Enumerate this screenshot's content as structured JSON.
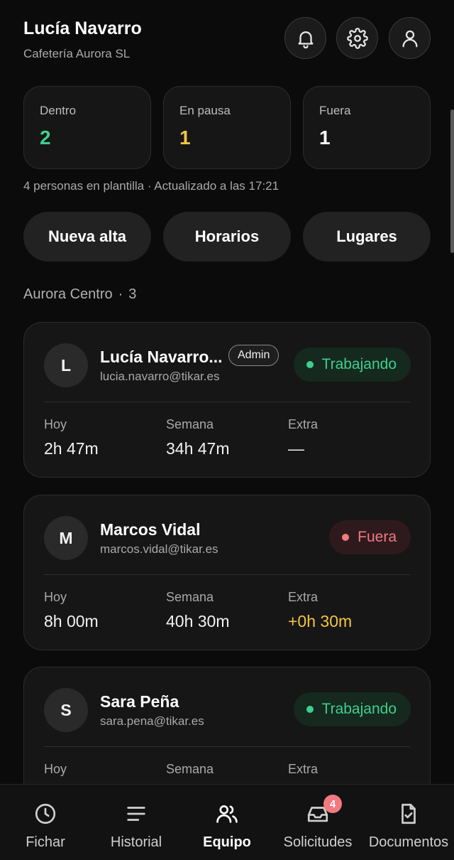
{
  "header": {
    "user_name": "Lucía Navarro",
    "company": "Cafetería Aurora SL",
    "buttons": [
      {
        "icon": "bell-icon"
      },
      {
        "icon": "gear-icon"
      },
      {
        "icon": "user-icon"
      }
    ]
  },
  "stats": [
    {
      "label": "Dentro",
      "value": "2",
      "color": "#3ecf8e"
    },
    {
      "label": "En pausa",
      "value": "1",
      "color": "#f5c542"
    },
    {
      "label": "Fuera",
      "value": "1",
      "color": "#ffffff"
    }
  ],
  "summary": "4 personas en plantilla · Actualizado a las 17:21",
  "actions": {
    "new_label": "Nueva alta",
    "schedules_label": "Horarios",
    "places_label": "Lugares"
  },
  "group": {
    "name": "Aurora Centro",
    "separator": "·",
    "count": "3"
  },
  "metric_labels": {
    "today": "Hoy",
    "week": "Semana",
    "extra": "Extra"
  },
  "employees": [
    {
      "initial": "L",
      "name": "Lucía Navarro...",
      "email": "lucia.navarro@tikar.es",
      "role": "Admin",
      "status": "Trabajando",
      "status_color": "#3ecf8e",
      "status_bg": "#15291f",
      "today": "2h 47m",
      "week": "34h 47m",
      "extra": "—",
      "extra_color": "#f2f2f2"
    },
    {
      "initial": "M",
      "name": "Marcos Vidal",
      "email": "marcos.vidal@tikar.es",
      "role": "",
      "status": "Fuera",
      "status_color": "#f07a80",
      "status_bg": "#2e1a1c",
      "today": "8h 00m",
      "week": "40h 30m",
      "extra": "+0h 30m",
      "extra_color": "#f5c542"
    },
    {
      "initial": "S",
      "name": "Sara Peña",
      "email": "sara.pena@tikar.es",
      "role": "",
      "status": "Trabajando",
      "status_color": "#3ecf8e",
      "status_bg": "#15291f",
      "today": "",
      "week": "",
      "extra": "",
      "extra_color": "#f2f2f2"
    }
  ],
  "nav": {
    "items": [
      {
        "label": "Fichar",
        "icon": "clock-icon",
        "active": false
      },
      {
        "label": "Historial",
        "icon": "list-icon",
        "active": false
      },
      {
        "label": "Equipo",
        "icon": "users-icon",
        "active": true
      },
      {
        "label": "Solicitudes",
        "icon": "inbox-icon",
        "active": false,
        "badge": "4"
      },
      {
        "label": "Documentos",
        "icon": "document-check-icon",
        "active": false
      }
    ]
  }
}
